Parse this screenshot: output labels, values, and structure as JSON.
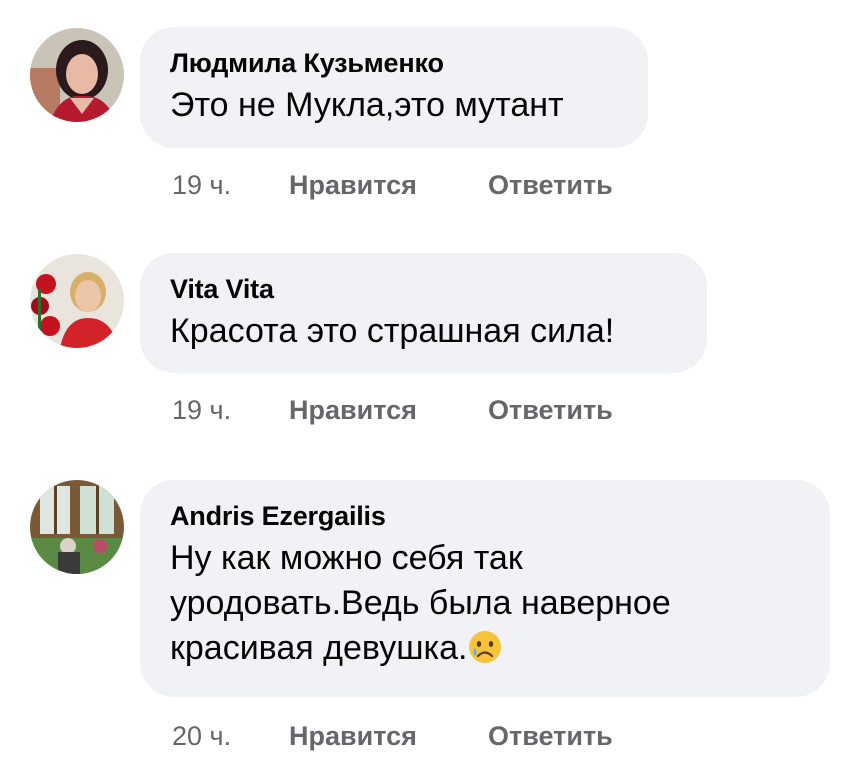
{
  "comments": [
    {
      "author": "Людмила Кузьменко",
      "text": "Это не Мукла,это мутант",
      "time": "19 ч.",
      "like": "Нравится",
      "reply": "Ответить"
    },
    {
      "author": "Vita Vita",
      "text": "Красота это страшная сила!",
      "time": "19 ч.",
      "like": "Нравится",
      "reply": "Ответить"
    },
    {
      "author": "Andris Ezergailis",
      "text_line1": "Ну как можно себя так",
      "text_line2": "уродовать.Ведь была наверное",
      "text_line3": "красивая девушка.",
      "emoji": "crying-face-icon",
      "time": "20 ч.",
      "like": "Нравится",
      "reply": "Ответить"
    }
  ],
  "colors": {
    "bubble": "#f0f2f5",
    "text": "#050505",
    "meta": "#65676b"
  }
}
